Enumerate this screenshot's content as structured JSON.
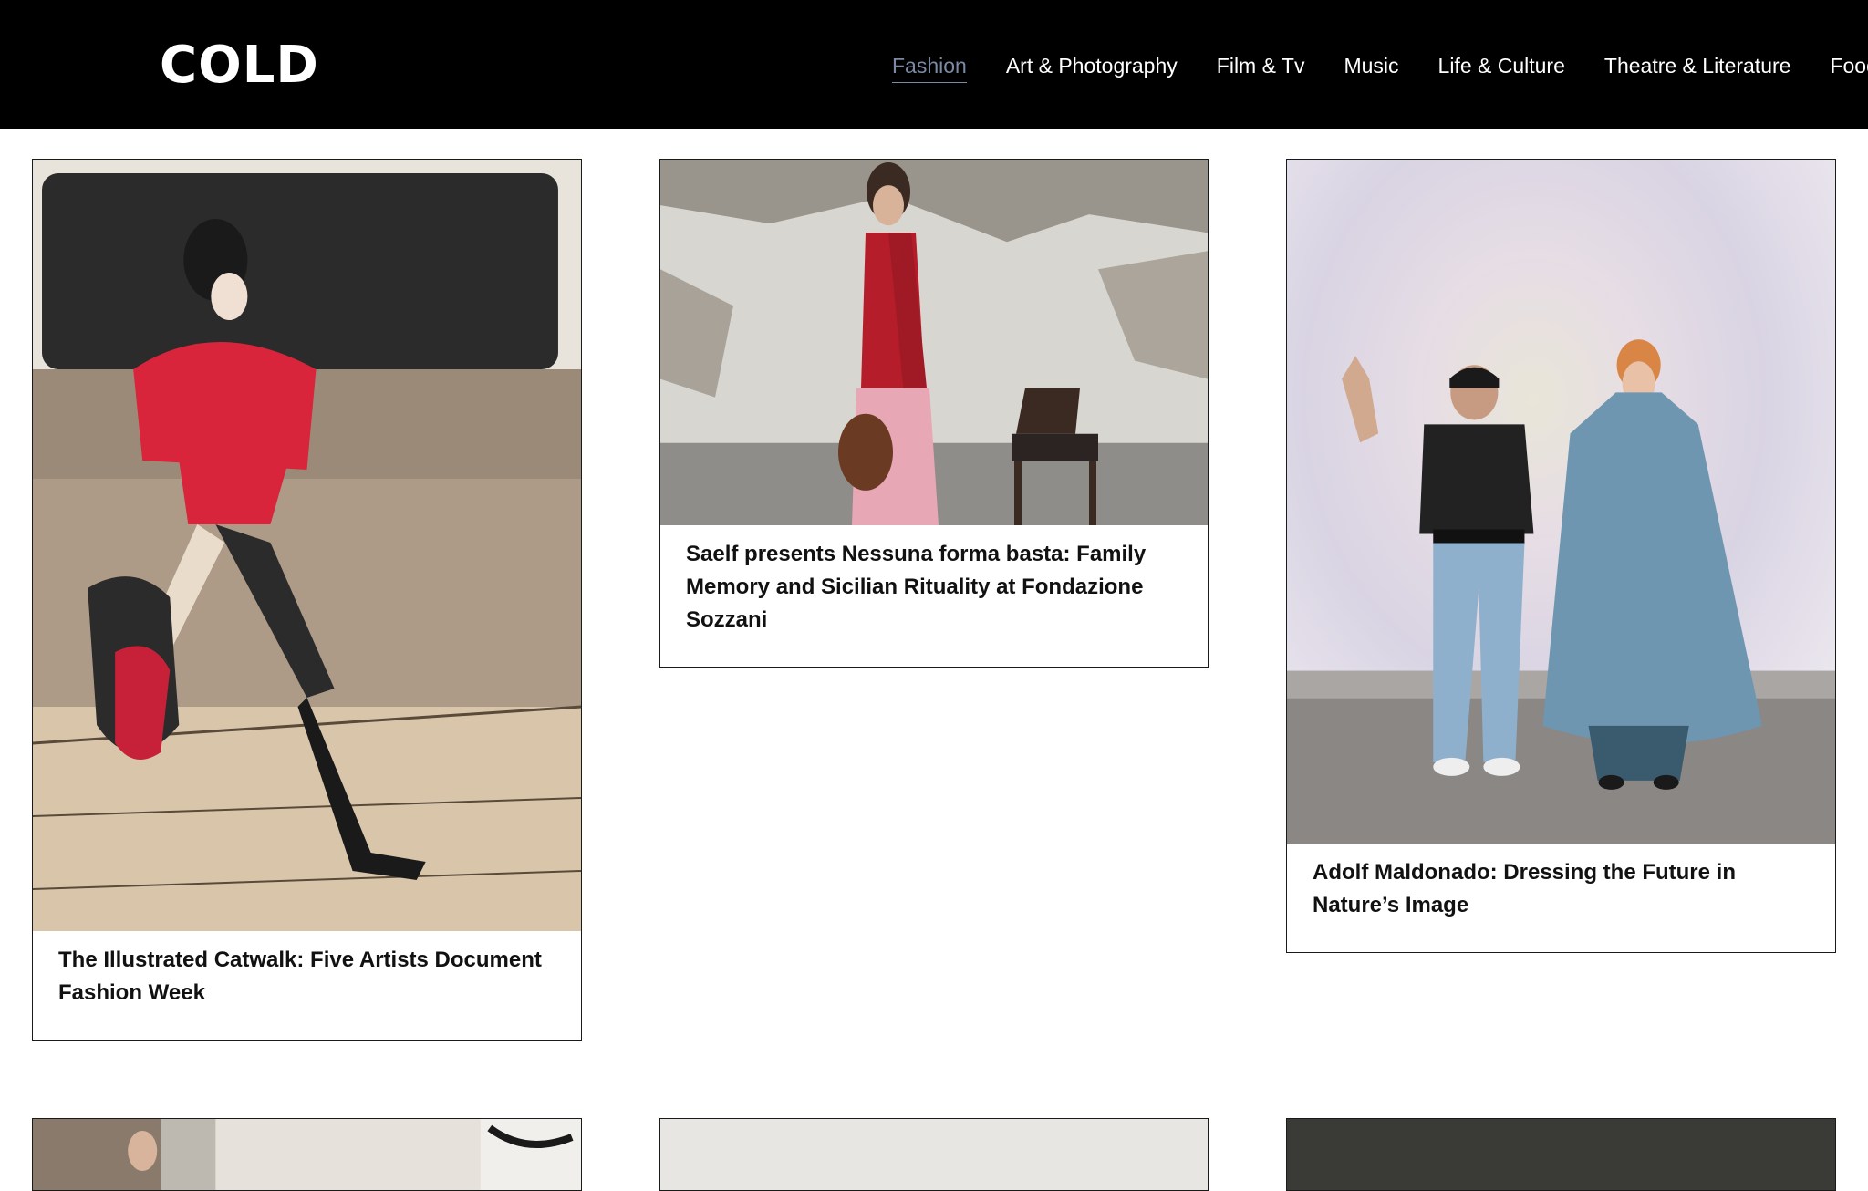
{
  "brand": {
    "logo": "COLD"
  },
  "nav": {
    "items": [
      {
        "label": "Fashion",
        "active": true
      },
      {
        "label": "Art & Photography"
      },
      {
        "label": "Film & Tv"
      },
      {
        "label": "Music"
      },
      {
        "label": "Life & Culture"
      },
      {
        "label": "Theatre & Literature"
      },
      {
        "label": "Food"
      }
    ]
  },
  "articles": [
    {
      "title": "The Illustrated Catwalk: Five Artists Document Fashion Week",
      "image": "watercolor-illustration-runway-model-red-outfit"
    },
    {
      "title": "Saelf presents Nessuna forma basta: Family Memory and Sicilian Rituality at Fondazione Sozzani",
      "image": "model-red-halter-pink-skirt-with-chair"
    },
    {
      "title": "Adolf Maldonado: Dressing the Future in Nature’s Image",
      "image": "designer-waving-with-model-blue-croc-coat"
    }
  ],
  "colors": {
    "header_bg": "#000000",
    "nav_active": "#7d8aa6",
    "text": "#111111"
  }
}
